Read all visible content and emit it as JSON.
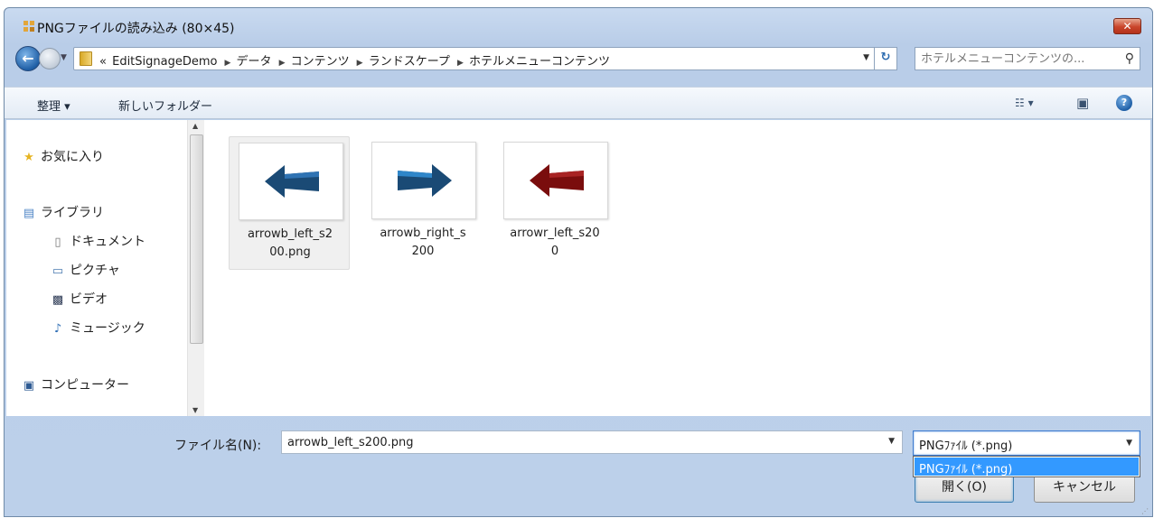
{
  "window": {
    "title": "PNGファイルの読み込み (80×45)",
    "close_label": "✕"
  },
  "nav": {
    "back_symbol": "←",
    "crumb_prefix": "«",
    "breadcrumbs": [
      "EditSignageDemo",
      "データ",
      "コンテンツ",
      "ランドスケープ",
      "ホテルメニューコンテンツ"
    ],
    "search_placeholder": "ホテルメニューコンテンツの...",
    "refresh_symbol": "↻"
  },
  "toolbar": {
    "organize_label": "整理 ▾",
    "new_folder_label": "新しいフォルダー",
    "view_symbol": "☷ ▾",
    "pane_symbol": "▣",
    "help_symbol": "?"
  },
  "sidebar": {
    "favorites": "お気に入り",
    "libraries": "ライブラリ",
    "documents": "ドキュメント",
    "pictures": "ピクチャ",
    "videos": "ビデオ",
    "music": "ミュージック",
    "computer": "コンピューター"
  },
  "files": [
    {
      "line1": "arrowb_left_s2",
      "line2": "00.png",
      "selected": true,
      "color": "#1a4a75",
      "direction": "left"
    },
    {
      "line1": "arrowb_right_s",
      "line2": "200",
      "selected": false,
      "color": "#1a4a75",
      "direction": "right"
    },
    {
      "line1": "arrowr_left_s20",
      "line2": "0",
      "selected": false,
      "color": "#7a0d0d",
      "direction": "left"
    }
  ],
  "bottom": {
    "filename_label": "ファイル名(N):",
    "filename_value": "arrowb_left_s200.png",
    "filetype_value": "PNGﾌｧｲﾙ (*.png)",
    "filetype_option": "PNGﾌｧｲﾙ (*.png)",
    "open_label": "開く(O)",
    "cancel_label": "キャンセル"
  },
  "colors": {
    "selection_blue": "#3399ff",
    "arrow_blue": "#1a4a75",
    "arrow_red": "#7a0d0d"
  }
}
